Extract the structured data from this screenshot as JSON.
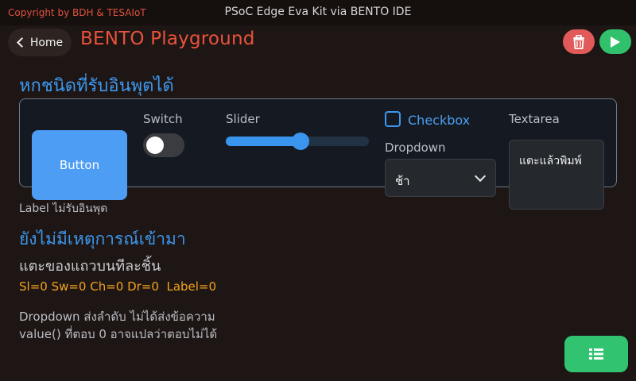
{
  "topbar": {
    "copyright": "Copyright by BDH & TESAIoT",
    "kit_title": "PSoC Edge Eva Kit via BENTO IDE"
  },
  "header": {
    "home_label": "Home",
    "app_title": "BENTO Playground"
  },
  "section": {
    "title": "หกชนิดที่รับอินพุตได้"
  },
  "widgets": {
    "button_label": "Button",
    "switch_label": "Switch",
    "switch_on": false,
    "slider_label": "Slider",
    "slider_fraction": 0.4,
    "checkbox_label": "Checkbox",
    "checkbox_checked": false,
    "dropdown_label": "Dropdown",
    "dropdown_value": "ช้า",
    "textarea_label": "Textarea",
    "textarea_value": "แตะแล้วพิมพ์"
  },
  "info": {
    "label_caption": "Label ไม่รับอินพุต",
    "event_title": "ยังไม่มีเหตุการณ์เข้ามา",
    "hint": "แตะของแถวบนทีละชิ้น",
    "status": "Sl=0 Sw=0 Ch=0 Dr=0  Label=0",
    "note_line1": "Dropdown ส่งลำดับ ไม่ได้ส่งข้อความ",
    "note_line2": "value() ที่ตอบ 0 อาจแปลว่าตอบไม่ได้"
  },
  "icons": {
    "delete": "trash-icon",
    "run": "play-icon",
    "home": "chevron-left-icon",
    "dropdown": "chevron-down-icon",
    "fab": "list-icon"
  },
  "colors": {
    "accent_blue": "#3d97ee",
    "title_red": "#e9523b",
    "delete_red": "#e05a5a",
    "run_green": "#31c06c",
    "status_orange": "#f2a21b"
  }
}
